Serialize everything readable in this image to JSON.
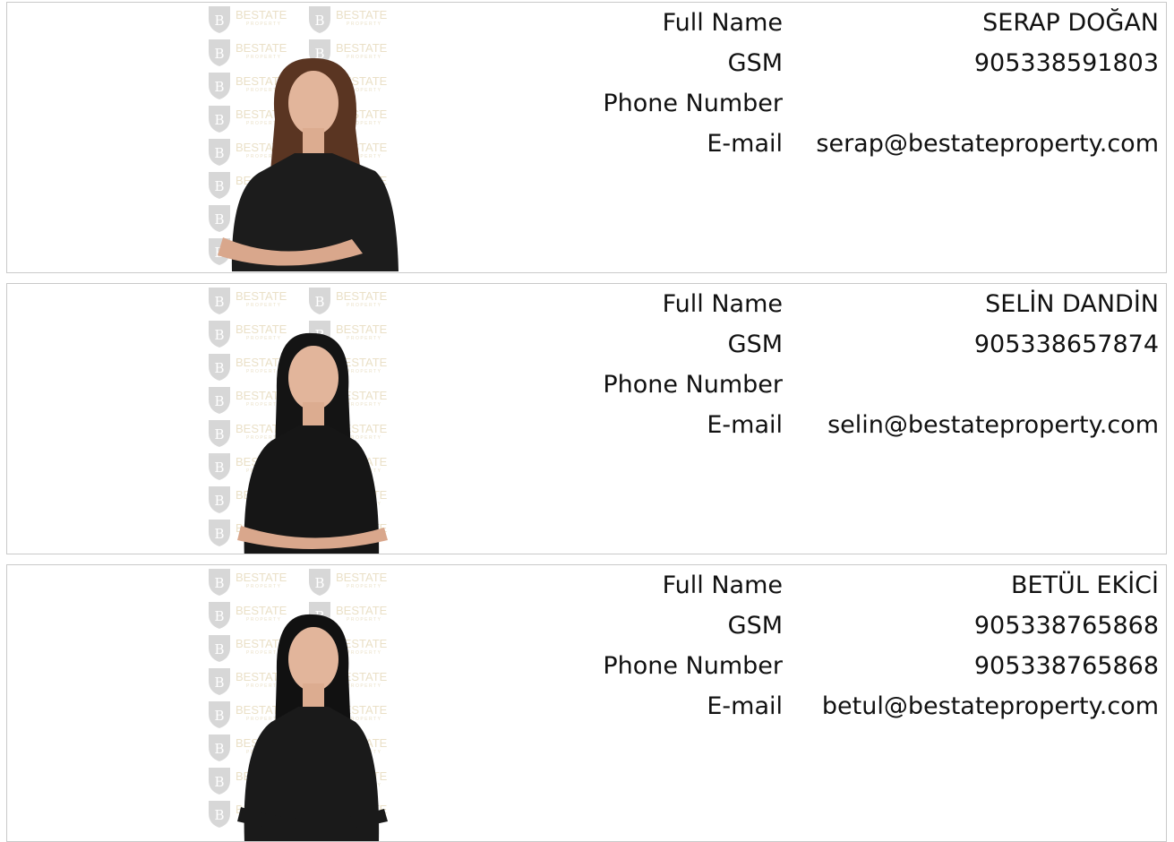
{
  "watermark": {
    "brand": "BESTATE",
    "sub": "PROPERTY",
    "logo_letter": "B",
    "color": "#d9c79a"
  },
  "labels": {
    "full_name": "Full Name",
    "gsm": "GSM",
    "phone": "Phone Number",
    "email": "E-mail"
  },
  "agents": [
    {
      "full_name": "SERAP DOĞAN",
      "gsm": "905338591803",
      "phone": "",
      "email": "serap@bestateproperty.com",
      "hair_color": "#5a3522",
      "outfit_color": "#1c1c1c"
    },
    {
      "full_name": "SELİN DANDİN",
      "gsm": "905338657874",
      "phone": "",
      "email": "selin@bestateproperty.com",
      "hair_color": "#141414",
      "outfit_color": "#161616"
    },
    {
      "full_name": "BETÜL EKİCİ",
      "gsm": "905338765868",
      "phone": "905338765868",
      "email": "betul@bestateproperty.com",
      "hair_color": "#111111",
      "outfit_color": "#1a1a1a"
    }
  ]
}
